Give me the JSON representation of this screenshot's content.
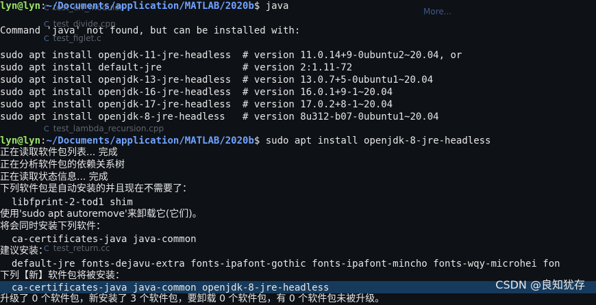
{
  "sidebar_ghost": {
    "more_label": "More...",
    "items": [
      "test_err_modules",
      "test_divide.cpp",
      "test_figlet.c",
      "test_lambda_recursion.cpp",
      "test_return.cc"
    ]
  },
  "terminal": {
    "prompt1": {
      "user": "lyn@lyn",
      "sep": ":",
      "path": "~/Documents/application/MATLAB/2020b",
      "symbol": "$",
      "command": " java"
    },
    "not_found": "Command 'java' not found, but can be installed with:",
    "suggestions": [
      "sudo apt install openjdk-11-jre-headless  # version 11.0.14+9-0ubuntu2~20.04, or",
      "sudo apt install default-jre              # version 2:1.11-72",
      "sudo apt install openjdk-13-jre-headless  # version 13.0.7+5-0ubuntu1~20.04",
      "sudo apt install openjdk-16-jre-headless  # version 16.0.1+9-1~20.04",
      "sudo apt install openjdk-17-jre-headless  # version 17.0.2+8-1~20.04",
      "sudo apt install openjdk-8-jre-headless   # version 8u312-b07-0ubuntu1~20.04"
    ],
    "prompt2": {
      "user": "lyn@lyn",
      "sep": ":",
      "path": "~/Documents/application/MATLAB/2020b",
      "symbol": "$",
      "command": " sudo apt install openjdk-8-jre-headless"
    },
    "output": [
      "正在读取软件包列表... 完成",
      "正在分析软件包的依赖关系树",
      "正在读取状态信息... 完成",
      "下列软件包是自动安装的并且现在不需要了：",
      "  libfprint-2-tod1 shim",
      "使用'sudo apt autoremove'来卸载它(它们)。",
      "将会同时安装下列软件：",
      "  ca-certificates-java java-common",
      "建议安装：",
      "  default-jre fonts-dejavu-extra fonts-ipafont-gothic fonts-ipafont-mincho fonts-wqy-microhei fon",
      "下列【新】软件包将被安装：",
      "  ca-certificates-java java-common openjdk-8-jre-headless",
      "升级了 0 个软件包，新安装了 3 个软件包，要卸载 0 个软件包，有 0 个软件包未被升级。"
    ]
  },
  "watermark": "CSDN @良知犹存",
  "colors": {
    "background": "#0e1116",
    "text": "#e6e6e6",
    "prompt_user": "#9be564",
    "prompt_path": "#6fa3ff",
    "highlight_row": "#163a5c"
  }
}
